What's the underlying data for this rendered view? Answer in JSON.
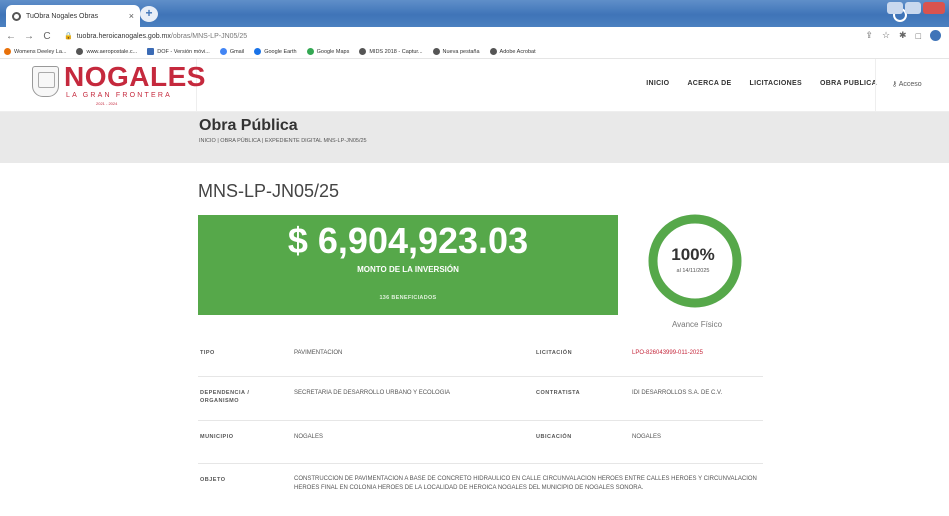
{
  "browser": {
    "tab_title": "TuObra Nogales Obras",
    "tab_close": "×",
    "new_tab": "+",
    "url_host": "tuobra.heroicanogales.gob.mx",
    "url_path": "/obras/MNS-LP-JN05/25",
    "nav": {
      "back": "←",
      "forward": "→",
      "reload": "C",
      "lock": "🔒"
    },
    "toolbar_icons": [
      "⇪",
      "☆",
      "✱",
      "□"
    ],
    "bookmarks": [
      {
        "label": "Womens Deeley La...",
        "color": "#e8710a"
      },
      {
        "label": "www.aeropostale.c...",
        "color": "#555555"
      },
      {
        "label": "DOF - Versión móvi...",
        "color": "#3b6bb5"
      },
      {
        "label": "Gmail",
        "color": "#4285f4"
      },
      {
        "label": "Google Earth",
        "color": "#1a73e8"
      },
      {
        "label": "Google Maps",
        "color": "#34a853"
      },
      {
        "label": "MIDS 2018 - Captur...",
        "color": "#555555"
      },
      {
        "label": "Nueva pestaña",
        "color": "#555555"
      },
      {
        "label": "Adobe Acrobat",
        "color": "#555555"
      }
    ]
  },
  "site": {
    "logo": {
      "name": "NOGALES",
      "tagline": "LA GRAN FRONTERA",
      "years": "2021 - 2024"
    },
    "nav": [
      "INICIO",
      "ACERCA DE",
      "LICITACIONES",
      "OBRA PUBLICA"
    ],
    "access": "Acceso",
    "access_icon": "⚷",
    "page_title": "Obra Pública",
    "breadcrumb": "INICIO | OBRA PÚBLICA | EXPEDIENTE DIGITAL MNS-LP-JN05/25"
  },
  "project": {
    "code": "MNS-LP-JN05/25",
    "amount": "$ 6,904,923.03",
    "amount_label": "MONTO DE LA INVERSIÓN",
    "beneficiaries": "136 BENEFICIADOS",
    "progress_text": "100%",
    "progress_fraction": 1.0,
    "progress_date": "al 14/11/2025",
    "progress_label": "Avance Físico",
    "colors": {
      "green": "#56a84a",
      "accent": "#c5293d"
    }
  },
  "details": {
    "tipo_label": "TIPO",
    "tipo": "PAVIMENTACION",
    "licitacion_label": "LICITACIÓN",
    "licitacion": "LPO-826043999-011-2025",
    "dependencia_label": "DEPENDENCIA / ORGANISMO",
    "dependencia": "SECRETARIA DE DESARROLLO URBANO Y ECOLOGIA",
    "contratista_label": "CONTRATISTA",
    "contratista": "IDI DESARROLLOS S.A. DE C.V.",
    "municipio_label": "MUNICIPIO",
    "municipio": "NOGALES",
    "ubicacion_label": "UBICACIÓN",
    "ubicacion": "NOGALES",
    "objeto_label": "OBJETO",
    "objeto": "CONSTRUCCION DE PAVIMENTACION A BASE DE CONCRETO HIDRAULICO EN CALLE CIRCUNVALACION HEROES ENTRE CALLES HEROES Y CIRCUNVALACION HEROES FINAL EN COLONIA HEROES DE LA LOCALIDAD DE HEROICA NOGALES DEL MUNICIPIO DE NOGALES SONORA."
  }
}
